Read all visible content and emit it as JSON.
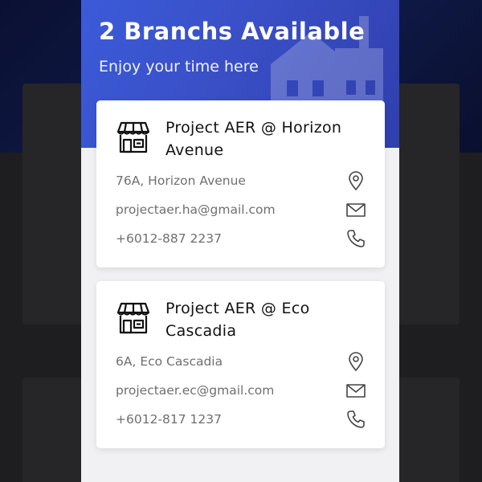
{
  "header": {
    "title": "2 Branchs Available",
    "subtitle": "Enjoy your time here"
  },
  "colors": {
    "header_gradient_start": "#3b5bd9",
    "header_gradient_end": "#2f3fae",
    "background": "#f1f1f3",
    "card": "#ffffff",
    "text_dark": "#111111",
    "text_muted": "#6f6f6f"
  },
  "branches": [
    {
      "name": "Project AER @ Horizon Avenue",
      "address": "76A, Horizon Avenue",
      "email": "projectaer.ha@gmail.com",
      "phone": "+6012-887 2237",
      "icons": {
        "store": "store-icon",
        "address": "location-pin-icon",
        "email": "mail-icon",
        "phone": "phone-icon"
      }
    },
    {
      "name": "Project AER @ Eco Cascadia",
      "address": "6A, Eco Cascadia",
      "email": "projectaer.ec@gmail.com",
      "phone": "+6012-817 1237",
      "icons": {
        "store": "store-icon",
        "address": "location-pin-icon",
        "email": "mail-icon",
        "phone": "phone-icon"
      }
    }
  ]
}
